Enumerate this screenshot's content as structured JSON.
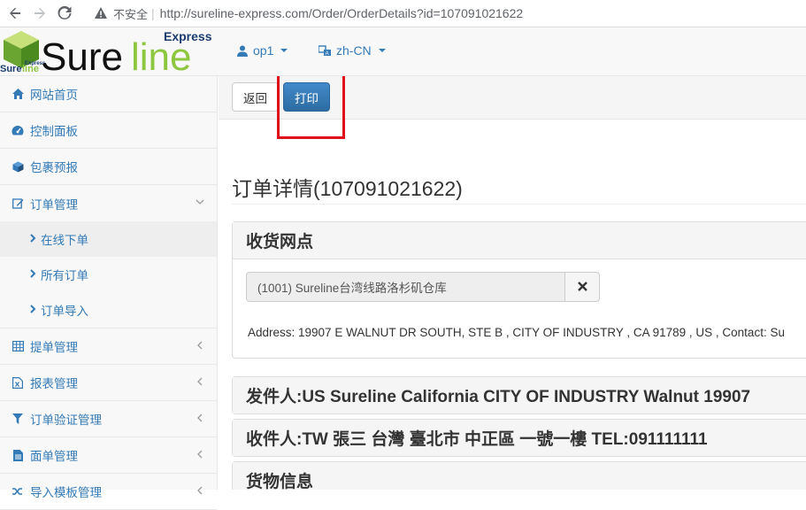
{
  "browser": {
    "insecure_label": "不安全",
    "separator": "|",
    "url": "http://sureline-express.com/Order/OrderDetails?id=107091021622"
  },
  "header": {
    "logo_text": "Sureline",
    "logo_sub": "Express",
    "user_menu": "op1",
    "lang_menu": "zh-CN"
  },
  "sidebar": {
    "items": [
      {
        "label": "网站首页",
        "icon": "home-icon"
      },
      {
        "label": "控制面板",
        "icon": "dashboard-icon"
      },
      {
        "label": "包裹预报",
        "icon": "cube-icon"
      },
      {
        "label": "订单管理",
        "icon": "edit-icon"
      },
      {
        "label": "提单管理",
        "icon": "table-icon"
      },
      {
        "label": "报表管理",
        "icon": "file-excel-icon"
      },
      {
        "label": "订单验证管理",
        "icon": "filter-icon"
      },
      {
        "label": "面单管理",
        "icon": "file-text-icon"
      },
      {
        "label": "导入模板管理",
        "icon": "random-icon"
      }
    ],
    "order_subitems": [
      {
        "label": "在线下单"
      },
      {
        "label": "所有订单"
      },
      {
        "label": "订单导入"
      }
    ]
  },
  "toolbar": {
    "back_label": "返回",
    "print_label": "打印"
  },
  "page": {
    "title": "订单详情(107091021622)"
  },
  "receiving": {
    "heading": "收货网点",
    "selected_value": "(1001) Sureline台湾线路洛杉矶仓库",
    "address": "Address: 19907 E WALNUT DR SOUTH, STE B , CITY OF INDUSTRY , CA 91789 , US , Contact: Su"
  },
  "sender": {
    "heading": "发件人:US Sureline California CITY OF INDUSTRY Walnut 19907"
  },
  "recipient": {
    "heading": "收件人:TW 張三 台灣 臺北市 中正區 一號一樓 TEL:091111111"
  },
  "cargo": {
    "heading": "货物信息"
  },
  "colors": {
    "link": "#337ab7",
    "primary_button": "#337ab7",
    "highlight": "#e0101a",
    "logo_green": "#8dc63f"
  }
}
